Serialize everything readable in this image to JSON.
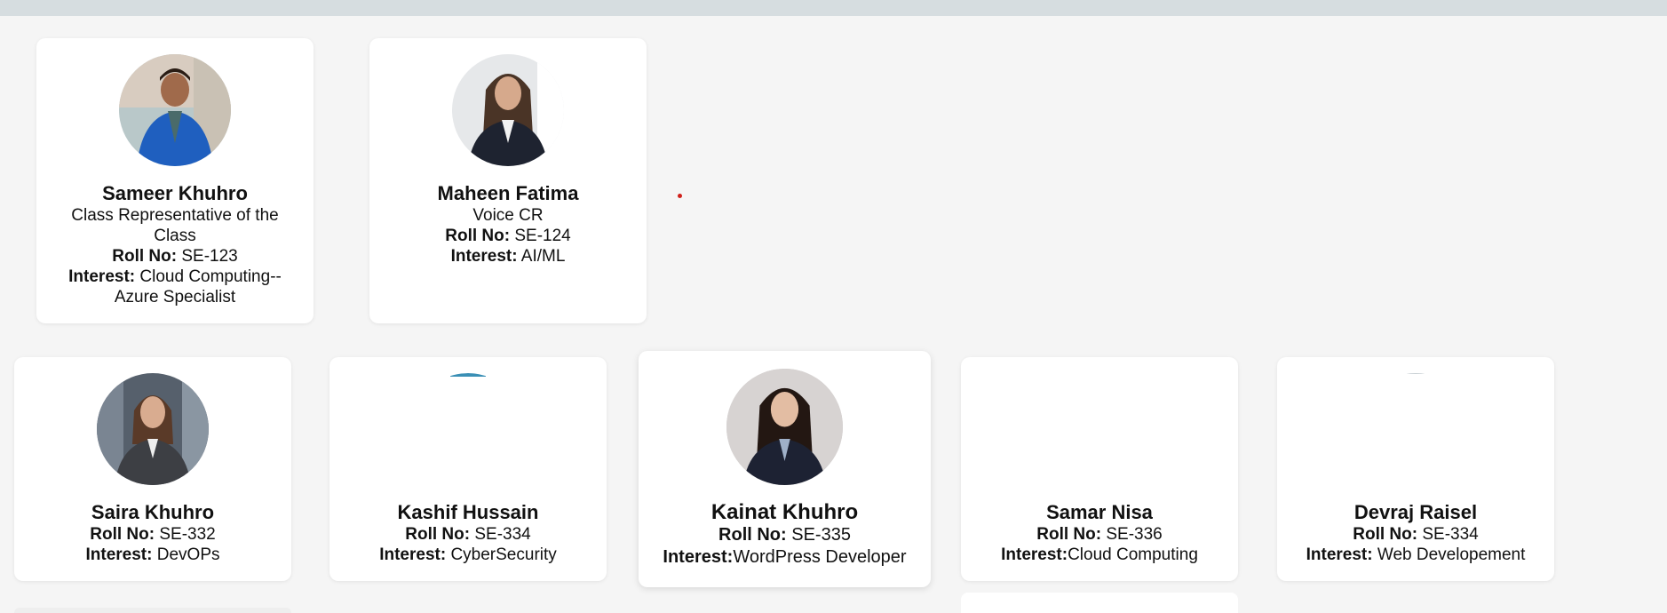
{
  "row1": [
    {
      "name": "Sameer Khuhro",
      "role": "Class Representative of the Class",
      "roll_label": "Roll No:",
      "roll": "SE-123",
      "interest_label": "Interest:",
      "interest": "Cloud Computing--Azure Specialist",
      "avatar_icon": "person-photo-blue-suit"
    },
    {
      "name": "Maheen Fatima",
      "role": "Voice CR",
      "roll_label": "Roll No:",
      "roll": "SE-124",
      "interest_label": "Interest:",
      "interest": "AI/ML",
      "avatar_icon": "person-photo-dark-suit"
    }
  ],
  "row2": [
    {
      "name": "Saira Khuhro",
      "roll_label": "Roll No:",
      "roll": "SE-332",
      "interest_label": "Interest:",
      "interest": "DevOPs",
      "avatar_icon": "person-photo-grey-suit"
    },
    {
      "name": "Kashif Hussain",
      "roll_label": "Roll No:",
      "roll": "SE-334",
      "interest_label": "Interest:",
      "interest": "CyberSecurity",
      "avatar_icon": "broken-image"
    },
    {
      "name": "Kainat Khuhro",
      "roll_label": "Roll No:",
      "roll": "SE-335",
      "interest_label": "Interest:",
      "interest": "WordPress Developer",
      "avatar_icon": "person-photo-navy-suit"
    },
    {
      "name": "Samar Nisa",
      "roll_label": "Roll No:",
      "roll": "SE-336",
      "interest_label": "Interest:",
      "interest": "Cloud Computing",
      "avatar_icon": "missing-image"
    },
    {
      "name": "Devraj Raisel",
      "roll_label": "Roll No:",
      "roll": "SE-334",
      "interest_label": "Interest:",
      "interest": "Web Developement",
      "avatar_icon": "missing-image"
    }
  ],
  "colors": {
    "background": "#f5f5f5",
    "card": "#ffffff",
    "topbar": "#d6dde0",
    "dot": "#d0201b"
  }
}
